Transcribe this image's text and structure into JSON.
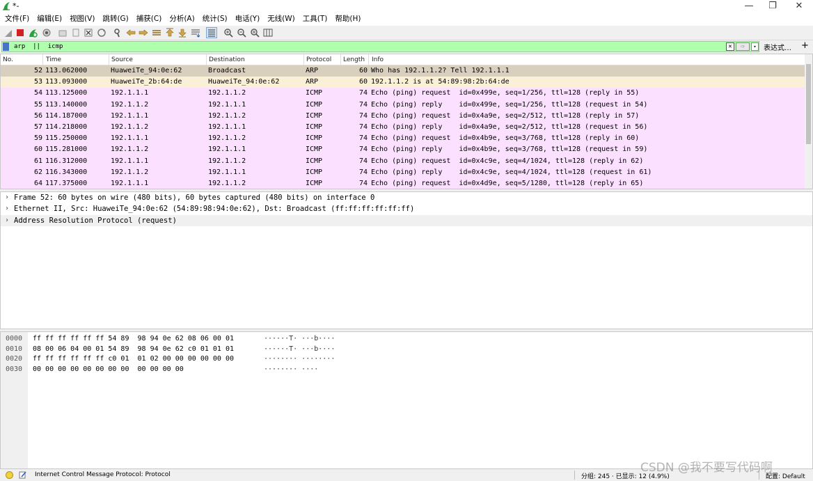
{
  "window": {
    "title": "*-",
    "minimize_glyph": "—",
    "restore_glyph": "❐",
    "close_glyph": "✕"
  },
  "menu": [
    "文件(F)",
    "编辑(E)",
    "视图(V)",
    "跳转(G)",
    "捕获(C)",
    "分析(A)",
    "统计(S)",
    "电话(Y)",
    "无线(W)",
    "工具(T)",
    "帮助(H)"
  ],
  "toolbar_icons": [
    "start-capture-icon",
    "stop-capture-icon",
    "restart-capture-icon",
    "capture-options-icon",
    "open-file-icon",
    "save-file-icon",
    "close-file-icon",
    "reload-file-icon",
    "find-packet-icon",
    "go-back-icon",
    "go-forward-icon",
    "go-to-packet-icon",
    "go-first-icon",
    "go-last-icon",
    "auto-scroll-icon",
    "colorize-icon",
    "zoom-in-icon",
    "zoom-out-icon",
    "normal-size-icon",
    "resize-columns-icon"
  ],
  "filter": {
    "value": "arp  ||  icmp",
    "clear_glyph": "✕",
    "apply_glyph": "⇨",
    "dropdown_glyph": "▾",
    "expression_label": "表达式…",
    "add_glyph": "+"
  },
  "packet_list": {
    "headers": [
      "No.",
      "Time",
      "Source",
      "Destination",
      "Protocol",
      "Length",
      "Info"
    ],
    "rows": [
      {
        "no": "52",
        "time": "113.062000",
        "src": "HuaweiTe_94:0e:62",
        "dst": "Broadcast",
        "proto": "ARP",
        "len": "60",
        "info": "Who has 192.1.1.2? Tell 192.1.1.1",
        "kind": "arp",
        "selected": true
      },
      {
        "no": "53",
        "time": "113.093000",
        "src": "HuaweiTe_2b:64:de",
        "dst": "HuaweiTe_94:0e:62",
        "proto": "ARP",
        "len": "60",
        "info": "192.1.1.2 is at 54:89:98:2b:64:de",
        "kind": "arp",
        "selected": false
      },
      {
        "no": "54",
        "time": "113.125000",
        "src": "192.1.1.1",
        "dst": "192.1.1.2",
        "proto": "ICMP",
        "len": "74",
        "info": "Echo (ping) request  id=0x499e, seq=1/256, ttl=128 (reply in 55)",
        "kind": "icmp",
        "selected": false
      },
      {
        "no": "55",
        "time": "113.140000",
        "src": "192.1.1.2",
        "dst": "192.1.1.1",
        "proto": "ICMP",
        "len": "74",
        "info": "Echo (ping) reply    id=0x499e, seq=1/256, ttl=128 (request in 54)",
        "kind": "icmp",
        "selected": false
      },
      {
        "no": "56",
        "time": "114.187000",
        "src": "192.1.1.1",
        "dst": "192.1.1.2",
        "proto": "ICMP",
        "len": "74",
        "info": "Echo (ping) request  id=0x4a9e, seq=2/512, ttl=128 (reply in 57)",
        "kind": "icmp",
        "selected": false
      },
      {
        "no": "57",
        "time": "114.218000",
        "src": "192.1.1.2",
        "dst": "192.1.1.1",
        "proto": "ICMP",
        "len": "74",
        "info": "Echo (ping) reply    id=0x4a9e, seq=2/512, ttl=128 (request in 56)",
        "kind": "icmp",
        "selected": false
      },
      {
        "no": "59",
        "time": "115.250000",
        "src": "192.1.1.1",
        "dst": "192.1.1.2",
        "proto": "ICMP",
        "len": "74",
        "info": "Echo (ping) request  id=0x4b9e, seq=3/768, ttl=128 (reply in 60)",
        "kind": "icmp",
        "selected": false
      },
      {
        "no": "60",
        "time": "115.281000",
        "src": "192.1.1.2",
        "dst": "192.1.1.1",
        "proto": "ICMP",
        "len": "74",
        "info": "Echo (ping) reply    id=0x4b9e, seq=3/768, ttl=128 (request in 59)",
        "kind": "icmp",
        "selected": false
      },
      {
        "no": "61",
        "time": "116.312000",
        "src": "192.1.1.1",
        "dst": "192.1.1.2",
        "proto": "ICMP",
        "len": "74",
        "info": "Echo (ping) request  id=0x4c9e, seq=4/1024, ttl=128 (reply in 62)",
        "kind": "icmp",
        "selected": false
      },
      {
        "no": "62",
        "time": "116.343000",
        "src": "192.1.1.2",
        "dst": "192.1.1.1",
        "proto": "ICMP",
        "len": "74",
        "info": "Echo (ping) reply    id=0x4c9e, seq=4/1024, ttl=128 (request in 61)",
        "kind": "icmp",
        "selected": false
      },
      {
        "no": "64",
        "time": "117.375000",
        "src": "192.1.1.1",
        "dst": "192.1.1.2",
        "proto": "ICMP",
        "len": "74",
        "info": "Echo (ping) request  id=0x4d9e, seq=5/1280, ttl=128 (reply in 65)",
        "kind": "icmp",
        "selected": false
      }
    ]
  },
  "details": [
    {
      "arrow": "›",
      "text": "Frame 52: 60 bytes on wire (480 bits), 60 bytes captured (480 bits) on interface 0",
      "selected": false
    },
    {
      "arrow": "›",
      "text": "Ethernet II, Src: HuaweiTe_94:0e:62 (54:89:98:94:0e:62), Dst: Broadcast (ff:ff:ff:ff:ff:ff)",
      "selected": false
    },
    {
      "arrow": "›",
      "text": "Address Resolution Protocol (request)",
      "selected": true
    }
  ],
  "bytes": [
    {
      "offset": "0000",
      "hex": "ff ff ff ff ff ff 54 89  98 94 0e 62 08 06 00 01",
      "ascii": "······T· ···b····"
    },
    {
      "offset": "0010",
      "hex": "08 00 06 04 00 01 54 89  98 94 0e 62 c0 01 01 01",
      "ascii": "······T· ···b····"
    },
    {
      "offset": "0020",
      "hex": "ff ff ff ff ff ff c0 01  01 02 00 00 00 00 00 00",
      "ascii": "········ ········"
    },
    {
      "offset": "0030",
      "hex": "00 00 00 00 00 00 00 00  00 00 00 00",
      "ascii": "········ ····"
    }
  ],
  "status": {
    "message": "Internet Control Message Protocol: Protocol",
    "stats": "分组: 245 · 已显示: 12 (4.9%)",
    "profile": "配置: Default"
  },
  "watermark": "CSDN @我不要写代码啊",
  "colors": {
    "arp_row": "#faf0d7",
    "arp_selected": "#d9cfbe",
    "icmp_row": "#fce0ff",
    "filter_ok": "#afffaf"
  }
}
